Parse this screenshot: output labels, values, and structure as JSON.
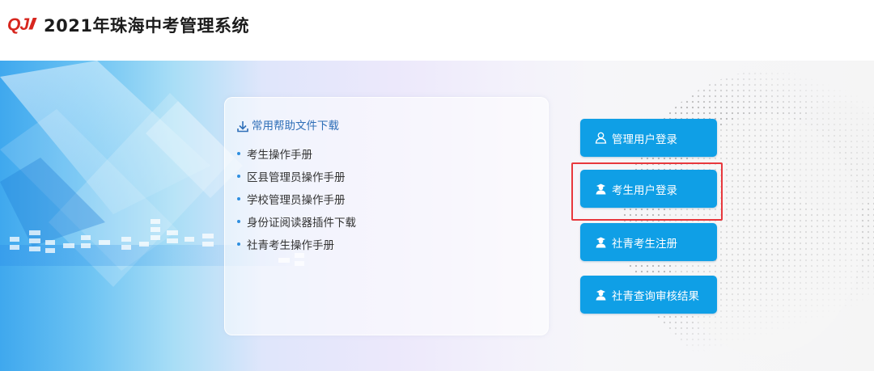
{
  "header": {
    "logo_text": "QJ",
    "logo_slashes": "///",
    "title": "2021年珠海中考管理系统"
  },
  "help": {
    "title": "常用帮助文件下载",
    "items": [
      "考生操作手册",
      "区县管理员操作手册",
      "学校管理员操作手册",
      "身份证阅读器插件下载",
      "社青考生操作手册"
    ]
  },
  "buttons": {
    "admin_login": "管理用户登录",
    "student_login": "考生用户登录",
    "social_register": "社青考生注册",
    "social_query": "社青查询审核结果"
  },
  "colors": {
    "logo_red": "#d7261e",
    "button_blue": "#0f9fe6",
    "link_blue": "#2f6fb8",
    "highlight_red": "#e8383d"
  }
}
